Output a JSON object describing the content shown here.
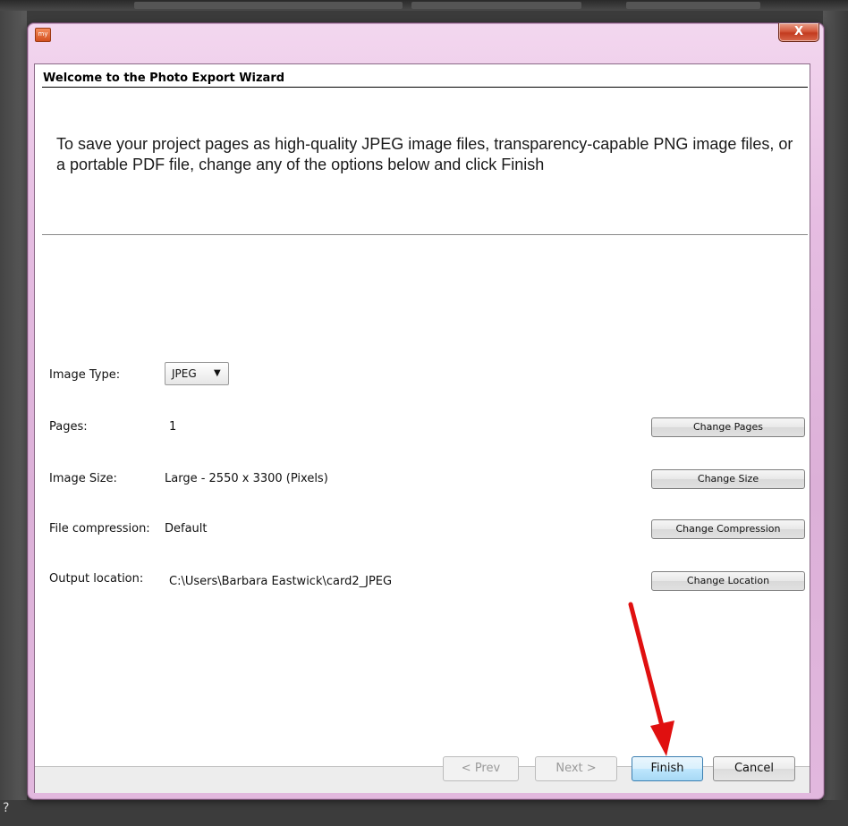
{
  "window": {
    "app_icon_text": "my",
    "close_glyph": "X",
    "icon": "close-icon"
  },
  "wizard": {
    "header_title": "Welcome to the Photo Export Wizard",
    "intro": "To save your project pages as high-quality JPEG image files, transparency-capable PNG image files, or a portable PDF file, change any of the options below and click Finish"
  },
  "options": {
    "image_type": {
      "label": "Image Type:",
      "value": "JPEG",
      "arrow": "▼"
    },
    "pages": {
      "label": "Pages:",
      "value": "1",
      "button": "Change Pages"
    },
    "image_size": {
      "label": "Image Size:",
      "value": "Large - 2550 x 3300 (Pixels)",
      "button": "Change Size"
    },
    "compression": {
      "label": "File compression:",
      "value": "Default",
      "button": "Change Compression"
    },
    "location": {
      "label": "Output location:",
      "value": "C:\\Users\\Barbara Eastwick\\card2_JPEG",
      "button": "Change Location"
    }
  },
  "footer": {
    "prev": "< Prev",
    "next": "Next >",
    "finish": "Finish",
    "cancel": "Cancel"
  },
  "annotation": {
    "color": "#e01010"
  },
  "corner_char": "?"
}
